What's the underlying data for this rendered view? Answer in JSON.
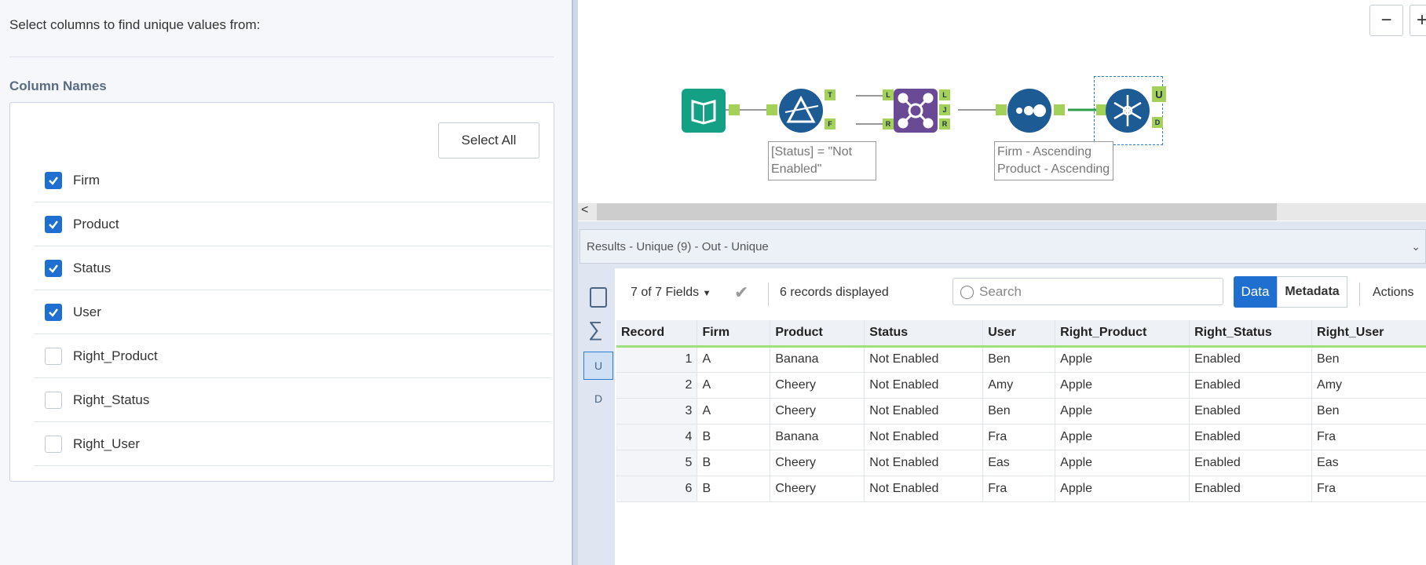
{
  "config": {
    "instruction": "Select columns to find unique values from:",
    "column_names_label": "Column Names",
    "select_all": "Select All",
    "columns": [
      {
        "name": "Firm",
        "checked": true
      },
      {
        "name": "Product",
        "checked": true
      },
      {
        "name": "Status",
        "checked": true
      },
      {
        "name": "User",
        "checked": true
      },
      {
        "name": "Right_Product",
        "checked": false
      },
      {
        "name": "Right_Status",
        "checked": false
      },
      {
        "name": "Right_User",
        "checked": false
      }
    ]
  },
  "canvas": {
    "zoom_out": "−",
    "zoom_in": "+",
    "filter_annotation": "[Status] = \"Not Enabled\"",
    "sort_annotation": "Firm - Ascending Product - Ascending",
    "ports": {
      "t": "T",
      "f": "F",
      "l": "L",
      "r": "R",
      "j": "J",
      "u": "U",
      "d": "D"
    }
  },
  "results": {
    "title": "Results - Unique (9) - Out - Unique",
    "fields": "7 of 7 Fields",
    "records": "6 records displayed",
    "search_placeholder": "Search",
    "data_tab": "Data",
    "metadata_tab": "Metadata",
    "actions": "Actions",
    "side_u": "U",
    "side_d": "D",
    "headers": [
      "Record",
      "Firm",
      "Product",
      "Status",
      "User",
      "Right_Product",
      "Right_Status",
      "Right_User"
    ],
    "rows": [
      [
        "1",
        "A",
        "Banana",
        "Not Enabled",
        "Ben",
        "Apple",
        "Enabled",
        "Ben"
      ],
      [
        "2",
        "A",
        "Cheery",
        "Not Enabled",
        "Amy",
        "Apple",
        "Enabled",
        "Amy"
      ],
      [
        "3",
        "A",
        "Cheery",
        "Not Enabled",
        "Ben",
        "Apple",
        "Enabled",
        "Ben"
      ],
      [
        "4",
        "B",
        "Banana",
        "Not Enabled",
        "Fra",
        "Apple",
        "Enabled",
        "Fra"
      ],
      [
        "5",
        "B",
        "Cheery",
        "Not Enabled",
        "Eas",
        "Apple",
        "Enabled",
        "Eas"
      ],
      [
        "6",
        "B",
        "Cheery",
        "Not Enabled",
        "Fra",
        "Apple",
        "Enabled",
        "Fra"
      ]
    ]
  }
}
